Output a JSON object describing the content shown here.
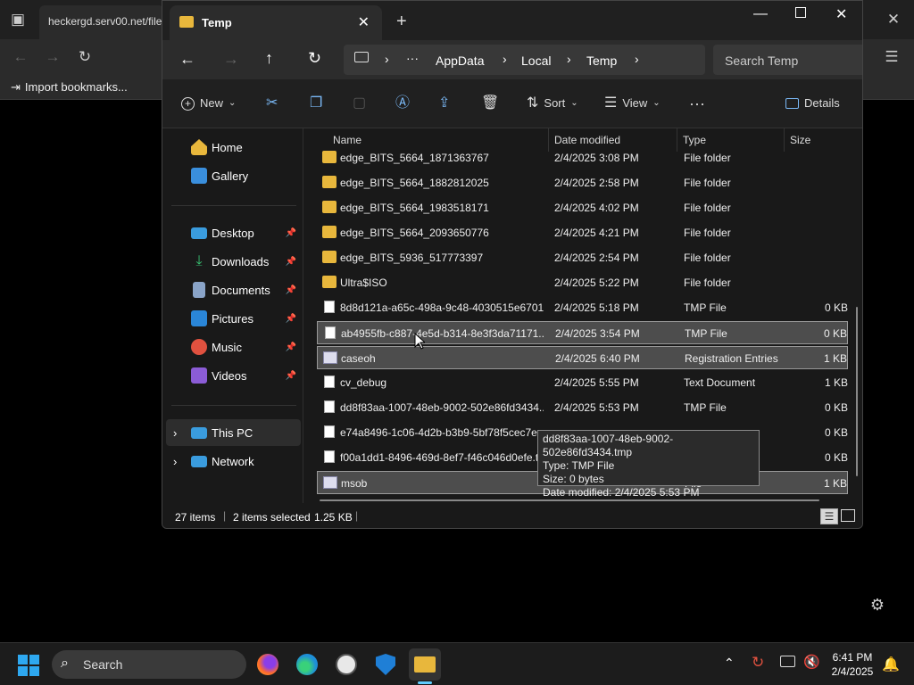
{
  "browser": {
    "tab_title": "heckergd.serv00.net/file",
    "import_bookmarks": "Import bookmarks..."
  },
  "window": {
    "tab_title": "Temp",
    "search_placeholder": "Search Temp",
    "breadcrumb": [
      "AppData",
      "Local",
      "Temp"
    ]
  },
  "toolbar": {
    "new_label": "New",
    "sort_label": "Sort",
    "view_label": "View",
    "details_label": "Details"
  },
  "nav": {
    "home": "Home",
    "gallery": "Gallery",
    "desktop": "Desktop",
    "downloads": "Downloads",
    "documents": "Documents",
    "pictures": "Pictures",
    "music": "Music",
    "videos": "Videos",
    "this_pc": "This PC",
    "network": "Network"
  },
  "columns": {
    "name": "Name",
    "date": "Date modified",
    "type": "Type",
    "size": "Size"
  },
  "files": [
    {
      "name": "edge_BITS_5664_1871363767",
      "date": "2/4/2025 3:08 PM",
      "type": "File folder",
      "size": "",
      "kind": "folder"
    },
    {
      "name": "edge_BITS_5664_1882812025",
      "date": "2/4/2025 2:58 PM",
      "type": "File folder",
      "size": "",
      "kind": "folder"
    },
    {
      "name": "edge_BITS_5664_1983518171",
      "date": "2/4/2025 4:02 PM",
      "type": "File folder",
      "size": "",
      "kind": "folder"
    },
    {
      "name": "edge_BITS_5664_2093650776",
      "date": "2/4/2025 4:21 PM",
      "type": "File folder",
      "size": "",
      "kind": "folder"
    },
    {
      "name": "edge_BITS_5936_517773397",
      "date": "2/4/2025 2:54 PM",
      "type": "File folder",
      "size": "",
      "kind": "folder"
    },
    {
      "name": "Ultra$ISO",
      "date": "2/4/2025 5:22 PM",
      "type": "File folder",
      "size": "",
      "kind": "folder"
    },
    {
      "name": "8d8d121a-a65c-498a-9c48-4030515e6701....",
      "date": "2/4/2025 5:18 PM",
      "type": "TMP File",
      "size": "0 KB",
      "kind": "file"
    },
    {
      "name": "ab4955fb-c887-4e5d-b314-8e3f3da71171....",
      "date": "2/4/2025 3:54 PM",
      "type": "TMP File",
      "size": "0 KB",
      "kind": "file"
    },
    {
      "name": "caseoh",
      "date": "2/4/2025 6:40 PM",
      "type": "Registration Entries",
      "size": "1 KB",
      "kind": "reg"
    },
    {
      "name": "cv_debug",
      "date": "2/4/2025 5:55 PM",
      "type": "Text Document",
      "size": "1 KB",
      "kind": "file"
    },
    {
      "name": "dd8f83aa-1007-48eb-9002-502e86fd3434....",
      "date": "2/4/2025 5:53 PM",
      "type": "TMP File",
      "size": "0 KB",
      "kind": "file"
    },
    {
      "name": "e74a8496-1c06-4d2b-b3b9-5bf78f5cec7e....",
      "date": "",
      "type": "",
      "size": "0 KB",
      "kind": "file"
    },
    {
      "name": "f00a1dd1-8496-469d-8ef7-f46c046d0efe.t...",
      "date": "",
      "type": "",
      "size": "0 KB",
      "kind": "file"
    },
    {
      "name": "msob",
      "date": "",
      "type": "File",
      "size": "1 KB",
      "kind": "reg"
    }
  ],
  "tooltip": {
    "line1": "dd8f83aa-1007-48eb-9002-502e86fd3434.tmp",
    "line2": "Type: TMP File",
    "line3": "Size: 0 bytes",
    "line4": "Date modified: 2/4/2025 5:53 PM"
  },
  "status": {
    "item_count": "27 items",
    "selection": "2 items selected",
    "selection_size": "1.25 KB"
  },
  "taskbar": {
    "search_label": "Search",
    "time": "6:41 PM",
    "date": "2/4/2025"
  },
  "colors": {
    "accent": "#60cdff",
    "folder": "#e8b73c",
    "selection": "#4d4d4d"
  }
}
